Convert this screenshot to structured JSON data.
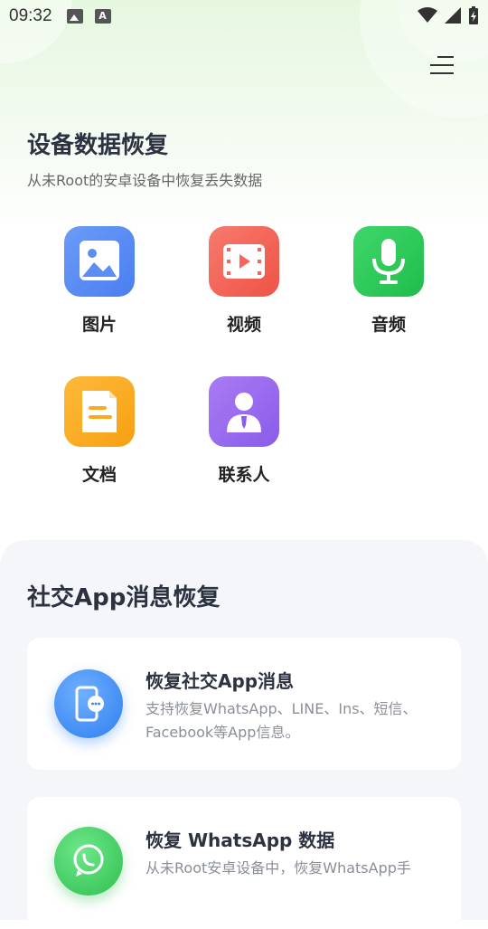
{
  "status_bar": {
    "time": "09:32"
  },
  "device_section": {
    "title": "设备数据恢复",
    "subtitle": "从未Root的安卓设备中恢复丢失数据",
    "items": [
      {
        "label": "图片",
        "icon": "picture-icon",
        "color": "#5b8df5"
      },
      {
        "label": "视频",
        "icon": "video-icon",
        "color": "#f5675a"
      },
      {
        "label": "音频",
        "icon": "microphone-icon",
        "color": "#2fcb5a"
      },
      {
        "label": "文档",
        "icon": "document-icon",
        "color": "#fbaa1e"
      },
      {
        "label": "联系人",
        "icon": "contact-icon",
        "color": "#9a6cf0"
      }
    ]
  },
  "social_section": {
    "title": "社交App消息恢复",
    "cards": [
      {
        "title": "恢复社交App消息",
        "desc": "支持恢复WhatsApp、LINE、Ins、短信、Facebook等App信息。",
        "icon": "phone-chat-icon",
        "color": "#3d8bf2"
      },
      {
        "title": "恢复 WhatsApp 数据",
        "desc": "从未Root安卓设备中，恢复WhatsApp手",
        "icon": "whatsapp-icon",
        "color": "#3fcf5b"
      }
    ]
  }
}
